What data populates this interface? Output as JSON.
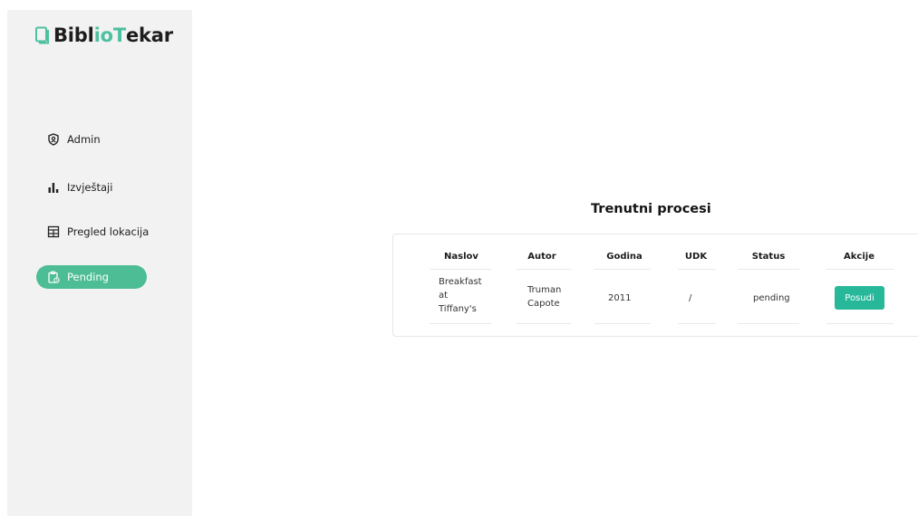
{
  "brand": {
    "part1": "Bibl",
    "part2": "io",
    "part3": "T",
    "part4": "ekar",
    "icon": "book-icon",
    "accent_color": "#4cc1a0"
  },
  "sidebar": {
    "items": [
      {
        "label": "Admin",
        "icon": "shield-icon",
        "active": false
      },
      {
        "label": "Izvještaji",
        "icon": "bar-chart-icon",
        "active": false
      },
      {
        "label": "Pregled lokacija",
        "icon": "location-grid-icon",
        "active": false
      },
      {
        "label": "Pending",
        "icon": "clipboard-clock-icon",
        "active": true
      }
    ],
    "active_color": "#4cbd95"
  },
  "main": {
    "title": "Trenutni procesi",
    "table": {
      "columns": [
        "Naslov",
        "Autor",
        "Godina",
        "UDK",
        "Status",
        "Akcije"
      ],
      "rows": [
        {
          "naslov_lines": [
            "Breakfast",
            "at",
            "Tiffany's"
          ],
          "autor_lines": [
            "Truman",
            "Capote"
          ],
          "godina": "2011",
          "udk": "/",
          "status": "pending",
          "action_label": "Posudi"
        }
      ]
    },
    "button_color": "#27b89a"
  }
}
